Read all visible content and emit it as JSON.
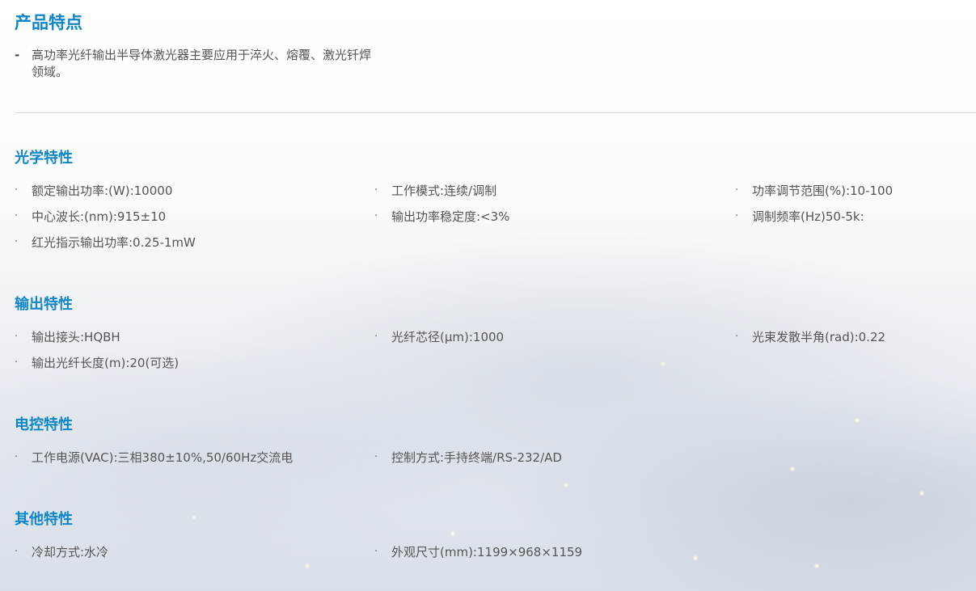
{
  "product_features": {
    "title": "产品特点",
    "bullet": "-",
    "description": "高功率光纤输出半导体激光器主要应用于淬火、熔覆、激光钎焊领域。"
  },
  "bullet_symbol": "·",
  "sections": {
    "optical": {
      "title": "光学特性",
      "items": [
        "额定输出功率:(W):10000",
        "工作模式:连续/调制",
        "功率调节范围(%):10-100",
        "中心波长:(nm):915±10",
        "输出功率稳定度:<3%",
        "调制频率(Hz)50-5k:",
        "红光指示输出功率:0.25-1mW"
      ]
    },
    "output": {
      "title": "输出特性",
      "items": [
        "输出接头:HQBH",
        "光纤芯径(μm):1000",
        "光束发散半角(rad):0.22",
        "输出光纤长度(m):20(可选)"
      ]
    },
    "electrical": {
      "title": "电控特性",
      "items": [
        "工作电源(VAC):三相380±10%,50/60Hz交流电",
        "控制方式:手持终端/RS-232/AD"
      ]
    },
    "other": {
      "title": "其他特性",
      "items": [
        "冷却方式:水冷",
        "外观尺寸(mm):1199×968×1159"
      ]
    }
  },
  "colors": {
    "heading": "#0f86c8",
    "body_text": "#555555",
    "divider": "#d9d9d9"
  }
}
